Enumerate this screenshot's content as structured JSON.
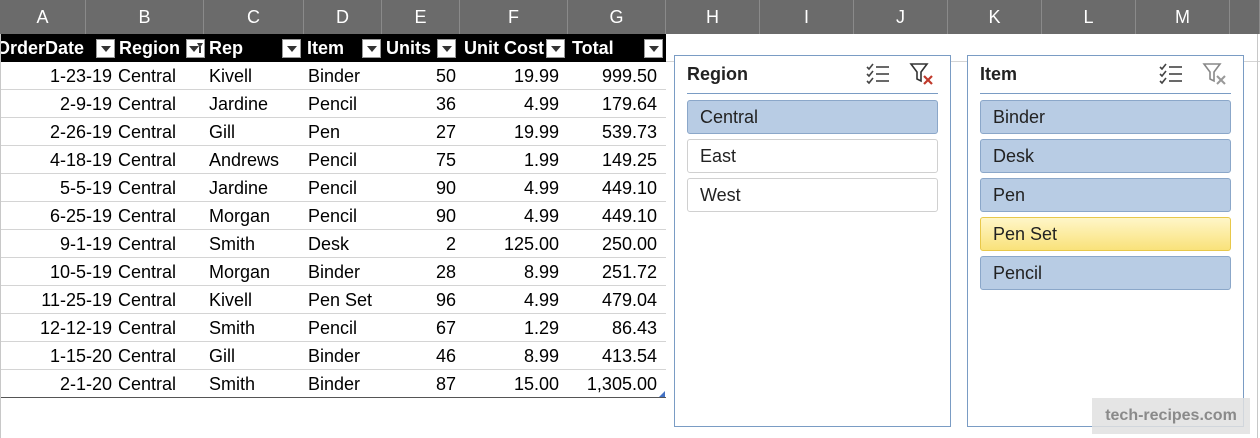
{
  "column_letters": [
    "A",
    "B",
    "C",
    "D",
    "E",
    "F",
    "G",
    "H",
    "I",
    "J",
    "K",
    "L",
    "M"
  ],
  "table": {
    "headers": [
      "OrderDate",
      "Region",
      "Rep",
      "Item",
      "Units",
      "Unit Cost",
      "Total"
    ],
    "rows": [
      [
        "1-23-19",
        "Central",
        "Kivell",
        "Binder",
        "50",
        "19.99",
        "999.50"
      ],
      [
        "2-9-19",
        "Central",
        "Jardine",
        "Pencil",
        "36",
        "4.99",
        "179.64"
      ],
      [
        "2-26-19",
        "Central",
        "Gill",
        "Pen",
        "27",
        "19.99",
        "539.73"
      ],
      [
        "4-18-19",
        "Central",
        "Andrews",
        "Pencil",
        "75",
        "1.99",
        "149.25"
      ],
      [
        "5-5-19",
        "Central",
        "Jardine",
        "Pencil",
        "90",
        "4.99",
        "449.10"
      ],
      [
        "6-25-19",
        "Central",
        "Morgan",
        "Pencil",
        "90",
        "4.99",
        "449.10"
      ],
      [
        "9-1-19",
        "Central",
        "Smith",
        "Desk",
        "2",
        "125.00",
        "250.00"
      ],
      [
        "10-5-19",
        "Central",
        "Morgan",
        "Binder",
        "28",
        "8.99",
        "251.72"
      ],
      [
        "11-25-19",
        "Central",
        "Kivell",
        "Pen Set",
        "96",
        "4.99",
        "479.04"
      ],
      [
        "12-12-19",
        "Central",
        "Smith",
        "Pencil",
        "67",
        "1.29",
        "86.43"
      ],
      [
        "1-15-20",
        "Central",
        "Gill",
        "Binder",
        "46",
        "8.99",
        "413.54"
      ],
      [
        "2-1-20",
        "Central",
        "Smith",
        "Binder",
        "87",
        "15.00",
        "1,305.00"
      ]
    ]
  },
  "region_slicer": {
    "title": "Region",
    "items": [
      {
        "label": "Central",
        "state": "selected"
      },
      {
        "label": "East",
        "state": "unselected"
      },
      {
        "label": "West",
        "state": "unselected"
      }
    ]
  },
  "item_slicer": {
    "title": "Item",
    "items": [
      {
        "label": "Binder",
        "state": "selected"
      },
      {
        "label": "Desk",
        "state": "selected"
      },
      {
        "label": "Pen",
        "state": "selected"
      },
      {
        "label": "Pen Set",
        "state": "hover"
      },
      {
        "label": "Pencil",
        "state": "selected"
      }
    ]
  },
  "watermark": "tech-recipes.com",
  "icons": {
    "multiselect": "multi-select-icon",
    "clear_filter": "clear-filter-icon"
  },
  "colors": {
    "header_bg": "#6b6b6b",
    "table_header_bg": "#000000",
    "slicer_selected": "#b8cce4",
    "slicer_hover": "#f9e27a",
    "slicer_border": "#7a9cc4",
    "clear_filter_active": "#c0392b"
  }
}
